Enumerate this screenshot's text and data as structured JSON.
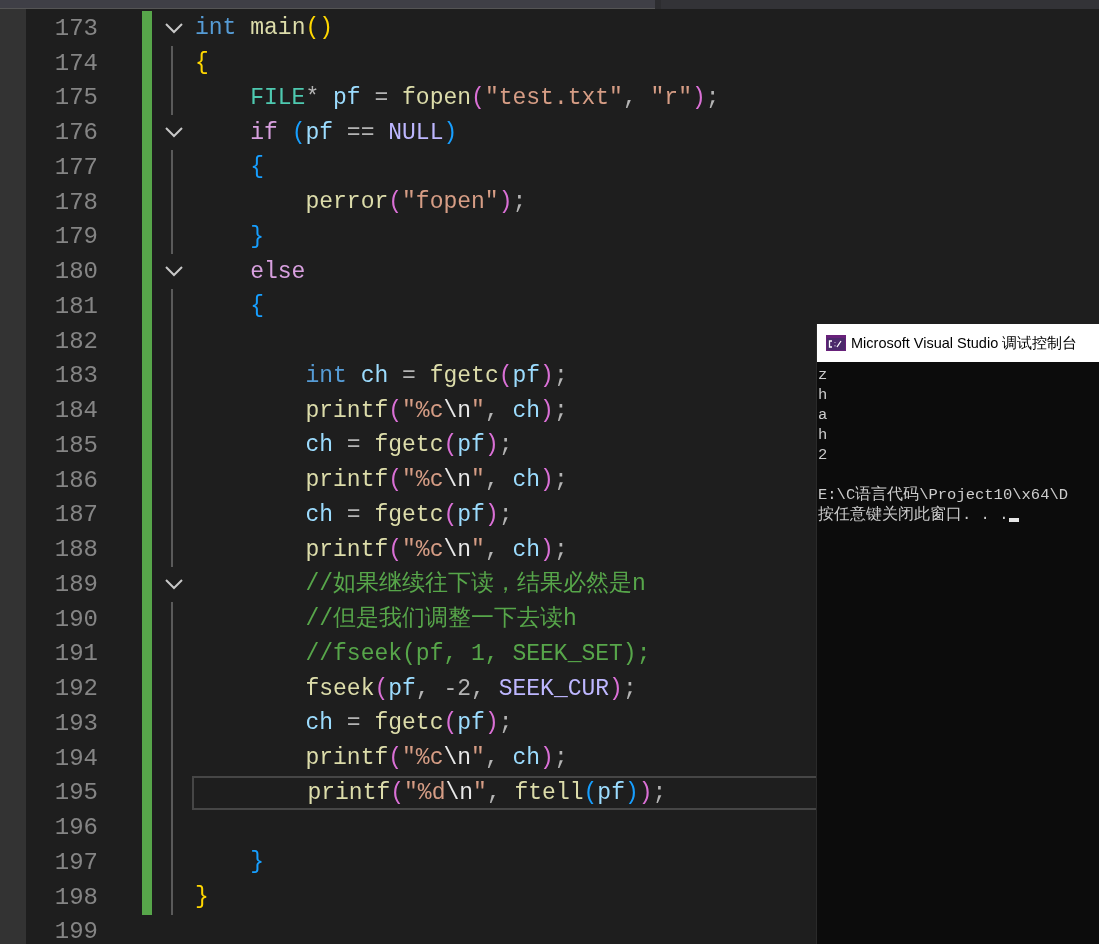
{
  "editor": {
    "lines": [
      {
        "number": "173",
        "changed": true,
        "fold_marker": true,
        "current": false,
        "tokens": [
          {
            "kind": "keyword",
            "text": "int"
          },
          {
            "kind": "function",
            "text": " main"
          },
          {
            "kind": "bracket1",
            "text": "()"
          }
        ]
      },
      {
        "number": "174",
        "changed": true,
        "fold_marker": false,
        "current": false,
        "tokens": [
          {
            "kind": "bracket1",
            "text": "{"
          }
        ]
      },
      {
        "number": "175",
        "changed": true,
        "fold_marker": false,
        "current": false,
        "tokens": [
          {
            "kind": "type",
            "text": "    FILE"
          },
          {
            "kind": "plain",
            "text": "* "
          },
          {
            "kind": "variable",
            "text": "pf"
          },
          {
            "kind": "plain",
            "text": " = "
          },
          {
            "kind": "function",
            "text": "fopen"
          },
          {
            "kind": "bracket2",
            "text": "("
          },
          {
            "kind": "string",
            "text": "\"test.txt\""
          },
          {
            "kind": "plain",
            "text": ", "
          },
          {
            "kind": "string",
            "text": "\"r\""
          },
          {
            "kind": "bracket2",
            "text": ")"
          },
          {
            "kind": "plain",
            "text": ";"
          }
        ]
      },
      {
        "number": "176",
        "changed": true,
        "fold_marker": true,
        "current": false,
        "tokens": [
          {
            "kind": "control",
            "text": "    if"
          },
          {
            "kind": "bracket3",
            "text": " ("
          },
          {
            "kind": "variable",
            "text": "pf"
          },
          {
            "kind": "plain",
            "text": " == "
          },
          {
            "kind": "macro",
            "text": "NULL"
          },
          {
            "kind": "bracket3",
            "text": ")"
          }
        ]
      },
      {
        "number": "177",
        "changed": true,
        "fold_marker": false,
        "current": false,
        "tokens": [
          {
            "kind": "bracket3",
            "text": "    {"
          }
        ]
      },
      {
        "number": "178",
        "changed": true,
        "fold_marker": false,
        "current": false,
        "tokens": [
          {
            "kind": "function",
            "text": "        perror"
          },
          {
            "kind": "bracket2",
            "text": "("
          },
          {
            "kind": "string",
            "text": "\"fopen\""
          },
          {
            "kind": "bracket2",
            "text": ")"
          },
          {
            "kind": "plain",
            "text": ";"
          }
        ]
      },
      {
        "number": "179",
        "changed": true,
        "fold_marker": false,
        "current": false,
        "tokens": [
          {
            "kind": "bracket3",
            "text": "    }"
          }
        ]
      },
      {
        "number": "180",
        "changed": true,
        "fold_marker": true,
        "current": false,
        "tokens": [
          {
            "kind": "control",
            "text": "    else"
          }
        ]
      },
      {
        "number": "181",
        "changed": true,
        "fold_marker": false,
        "current": false,
        "tokens": [
          {
            "kind": "bracket3",
            "text": "    {"
          }
        ]
      },
      {
        "number": "182",
        "changed": true,
        "fold_marker": false,
        "current": false
      },
      {
        "number": "183",
        "changed": true,
        "fold_marker": false,
        "current": false,
        "tokens": [
          {
            "kind": "keyword",
            "text": "        int"
          },
          {
            "kind": "variable",
            "text": " ch"
          },
          {
            "kind": "plain",
            "text": " = "
          },
          {
            "kind": "function",
            "text": "fgetc"
          },
          {
            "kind": "bracket2",
            "text": "("
          },
          {
            "kind": "variable",
            "text": "pf"
          },
          {
            "kind": "bracket2",
            "text": ")"
          },
          {
            "kind": "plain",
            "text": ";"
          }
        ]
      },
      {
        "number": "184",
        "changed": true,
        "fold_marker": false,
        "current": false,
        "tokens": [
          {
            "kind": "function",
            "text": "        printf"
          },
          {
            "kind": "bracket2",
            "text": "("
          },
          {
            "kind": "string",
            "text": "\"%c"
          },
          {
            "kind": "escape",
            "text": "\\n"
          },
          {
            "kind": "string",
            "text": "\""
          },
          {
            "kind": "plain",
            "text": ", "
          },
          {
            "kind": "variable",
            "text": "ch"
          },
          {
            "kind": "bracket2",
            "text": ")"
          },
          {
            "kind": "plain",
            "text": ";"
          }
        ]
      },
      {
        "number": "185",
        "changed": true,
        "fold_marker": false,
        "current": false,
        "tokens": [
          {
            "kind": "variable",
            "text": "        ch"
          },
          {
            "kind": "plain",
            "text": " = "
          },
          {
            "kind": "function",
            "text": "fgetc"
          },
          {
            "kind": "bracket2",
            "text": "("
          },
          {
            "kind": "variable",
            "text": "pf"
          },
          {
            "kind": "bracket2",
            "text": ")"
          },
          {
            "kind": "plain",
            "text": ";"
          }
        ]
      },
      {
        "number": "186",
        "changed": true,
        "fold_marker": false,
        "current": false,
        "tokens": [
          {
            "kind": "function",
            "text": "        printf"
          },
          {
            "kind": "bracket2",
            "text": "("
          },
          {
            "kind": "string",
            "text": "\"%c"
          },
          {
            "kind": "escape",
            "text": "\\n"
          },
          {
            "kind": "string",
            "text": "\""
          },
          {
            "kind": "plain",
            "text": ", "
          },
          {
            "kind": "variable",
            "text": "ch"
          },
          {
            "kind": "bracket2",
            "text": ")"
          },
          {
            "kind": "plain",
            "text": ";"
          }
        ]
      },
      {
        "number": "187",
        "changed": true,
        "fold_marker": false,
        "current": false,
        "tokens": [
          {
            "kind": "variable",
            "text": "        ch"
          },
          {
            "kind": "plain",
            "text": " = "
          },
          {
            "kind": "function",
            "text": "fgetc"
          },
          {
            "kind": "bracket2",
            "text": "("
          },
          {
            "kind": "variable",
            "text": "pf"
          },
          {
            "kind": "bracket2",
            "text": ")"
          },
          {
            "kind": "plain",
            "text": ";"
          }
        ]
      },
      {
        "number": "188",
        "changed": true,
        "fold_marker": false,
        "current": false,
        "tokens": [
          {
            "kind": "function",
            "text": "        printf"
          },
          {
            "kind": "bracket2",
            "text": "("
          },
          {
            "kind": "string",
            "text": "\"%c"
          },
          {
            "kind": "escape",
            "text": "\\n"
          },
          {
            "kind": "string",
            "text": "\""
          },
          {
            "kind": "plain",
            "text": ", "
          },
          {
            "kind": "variable",
            "text": "ch"
          },
          {
            "kind": "bracket2",
            "text": ")"
          },
          {
            "kind": "plain",
            "text": ";"
          }
        ]
      },
      {
        "number": "189",
        "changed": true,
        "fold_marker": true,
        "current": false,
        "tokens": [
          {
            "kind": "comment",
            "text": "        //如果继续往下读，结果必然是n"
          }
        ]
      },
      {
        "number": "190",
        "changed": true,
        "fold_marker": false,
        "current": false,
        "tokens": [
          {
            "kind": "comment",
            "text": "        //但是我们调整一下去读h"
          }
        ]
      },
      {
        "number": "191",
        "changed": true,
        "fold_marker": false,
        "current": false,
        "tokens": [
          {
            "kind": "comment",
            "text": "        //fseek(pf, 1, SEEK_SET);"
          }
        ]
      },
      {
        "number": "192",
        "changed": true,
        "fold_marker": false,
        "current": false,
        "tokens": [
          {
            "kind": "function",
            "text": "        fseek"
          },
          {
            "kind": "bracket2",
            "text": "("
          },
          {
            "kind": "variable",
            "text": "pf"
          },
          {
            "kind": "plain",
            "text": ", -2, "
          },
          {
            "kind": "macro",
            "text": "SEEK_CUR"
          },
          {
            "kind": "bracket2",
            "text": ")"
          },
          {
            "kind": "plain",
            "text": ";"
          }
        ]
      },
      {
        "number": "193",
        "changed": true,
        "fold_marker": false,
        "current": false,
        "tokens": [
          {
            "kind": "variable",
            "text": "        ch"
          },
          {
            "kind": "plain",
            "text": " = "
          },
          {
            "kind": "function",
            "text": "fgetc"
          },
          {
            "kind": "bracket2",
            "text": "("
          },
          {
            "kind": "variable",
            "text": "pf"
          },
          {
            "kind": "bracket2",
            "text": ")"
          },
          {
            "kind": "plain",
            "text": ";"
          }
        ]
      },
      {
        "number": "194",
        "changed": true,
        "fold_marker": false,
        "current": false,
        "tokens": [
          {
            "kind": "function",
            "text": "        printf"
          },
          {
            "kind": "bracket2",
            "text": "("
          },
          {
            "kind": "string",
            "text": "\"%c"
          },
          {
            "kind": "escape",
            "text": "\\n"
          },
          {
            "kind": "string",
            "text": "\""
          },
          {
            "kind": "plain",
            "text": ", "
          },
          {
            "kind": "variable",
            "text": "ch"
          },
          {
            "kind": "bracket2",
            "text": ")"
          },
          {
            "kind": "plain",
            "text": ";"
          }
        ]
      },
      {
        "number": "195",
        "changed": true,
        "fold_marker": false,
        "current": true,
        "tokens": [
          {
            "kind": "function",
            "text": "        printf"
          },
          {
            "kind": "bracket2",
            "text": "("
          },
          {
            "kind": "string",
            "text": "\"%d"
          },
          {
            "kind": "escape",
            "text": "\\n"
          },
          {
            "kind": "string",
            "text": "\""
          },
          {
            "kind": "plain",
            "text": ", "
          },
          {
            "kind": "function",
            "text": "ftell"
          },
          {
            "kind": "bracket3",
            "text": "("
          },
          {
            "kind": "variable",
            "text": "pf"
          },
          {
            "kind": "bracket3",
            "text": ")"
          },
          {
            "kind": "bracket2",
            "text": ")"
          },
          {
            "kind": "plain",
            "text": ";"
          }
        ]
      },
      {
        "number": "196",
        "changed": true,
        "fold_marker": false,
        "current": false
      },
      {
        "number": "197",
        "changed": true,
        "fold_marker": false,
        "current": false,
        "tokens": [
          {
            "kind": "bracket3",
            "text": "    }"
          }
        ]
      },
      {
        "number": "198",
        "changed": true,
        "fold_marker": false,
        "current": false,
        "tokens": [
          {
            "kind": "bracket1",
            "text": "}"
          }
        ]
      },
      {
        "number": "199",
        "changed": false,
        "fold_marker": false,
        "current": false
      }
    ]
  },
  "console": {
    "title": "Microsoft Visual Studio 调试控制台",
    "output": [
      "z",
      "h",
      "a",
      "h",
      "2"
    ],
    "exit_message": "E:\\C语言代码\\Project10\\x64\\D",
    "prompt": "按任意键关闭此窗口. . ."
  }
}
